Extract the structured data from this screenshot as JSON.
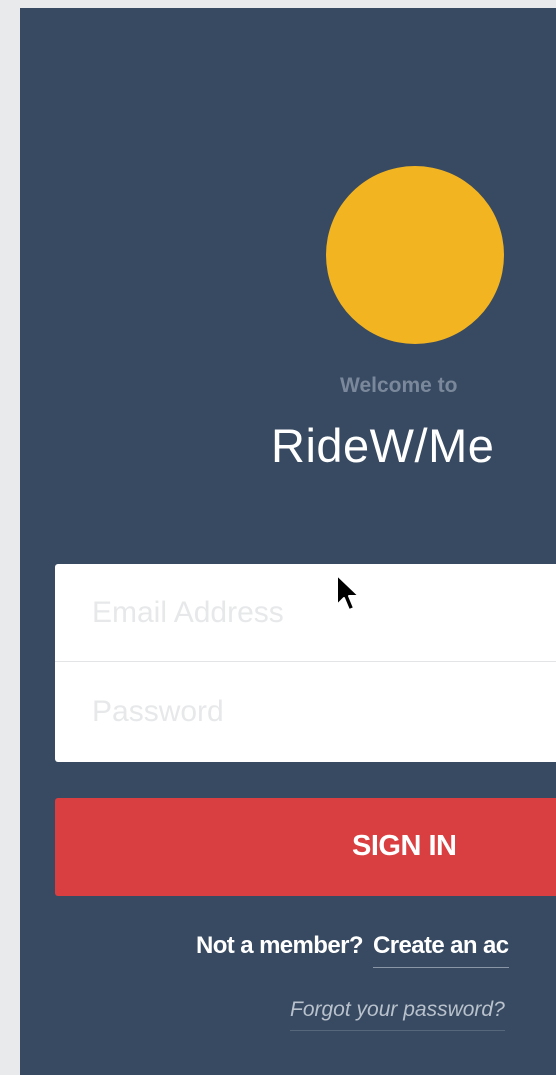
{
  "welcome_text": "Welcome to",
  "app_title": "RideW/Me",
  "form": {
    "email_placeholder": "Email Address",
    "email_value": "",
    "password_placeholder": "Password",
    "password_value": ""
  },
  "signin_label": "SIGN IN",
  "signup": {
    "prompt": "Not a member?",
    "link_label": "Create an ac"
  },
  "forgot_label": "Forgot your password?",
  "colors": {
    "background": "#374a61",
    "logo": "#f3b422",
    "signin_button": "#d93f40"
  },
  "icons": {
    "logo": "logo-circle-icon",
    "cursor": "mouse-pointer-icon"
  }
}
